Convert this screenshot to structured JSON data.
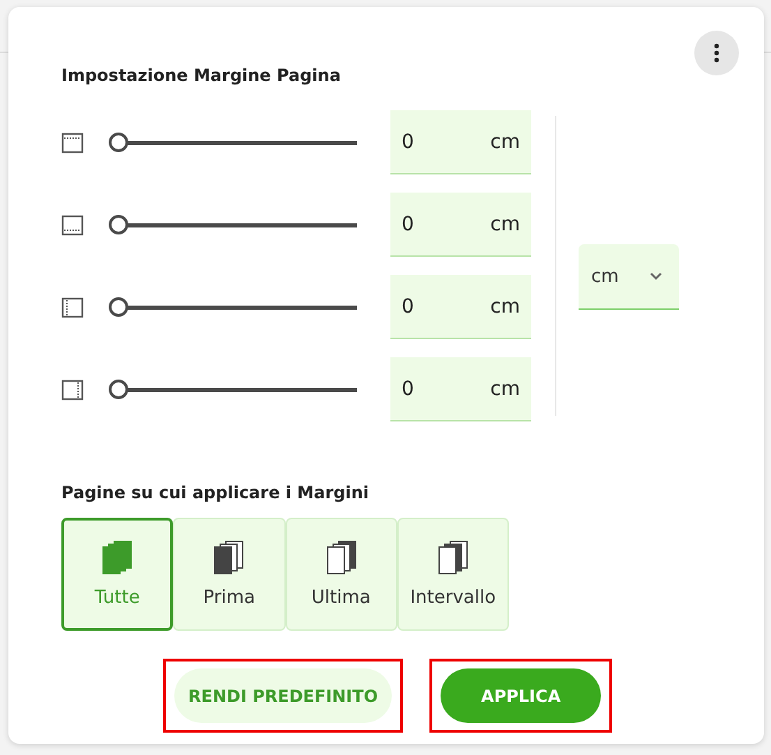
{
  "title": "Impostazione Margine Pagina",
  "margins": [
    {
      "kind": "top",
      "level": 0,
      "value": "0",
      "unit": "cm"
    },
    {
      "kind": "bottom",
      "level": 0,
      "value": "0",
      "unit": "cm"
    },
    {
      "kind": "left",
      "level": 0,
      "value": "0",
      "unit": "cm"
    },
    {
      "kind": "right",
      "level": 0,
      "value": "0",
      "unit": "cm"
    }
  ],
  "unit_select": {
    "value": "cm"
  },
  "pages_title": "Pagine su cui applicare i Margini",
  "pages": [
    {
      "kind": "all",
      "label": "Tutte",
      "selected": true
    },
    {
      "kind": "first",
      "label": "Prima",
      "selected": false
    },
    {
      "kind": "last",
      "label": "Ultima",
      "selected": false
    },
    {
      "kind": "range",
      "label": "Intervallo",
      "selected": false
    }
  ],
  "buttons": [
    {
      "kind": "secondary",
      "label": "RENDI PREDEFINITO",
      "highlighted": true
    },
    {
      "kind": "primary",
      "label": "APPLICA",
      "highlighted": true
    }
  ]
}
